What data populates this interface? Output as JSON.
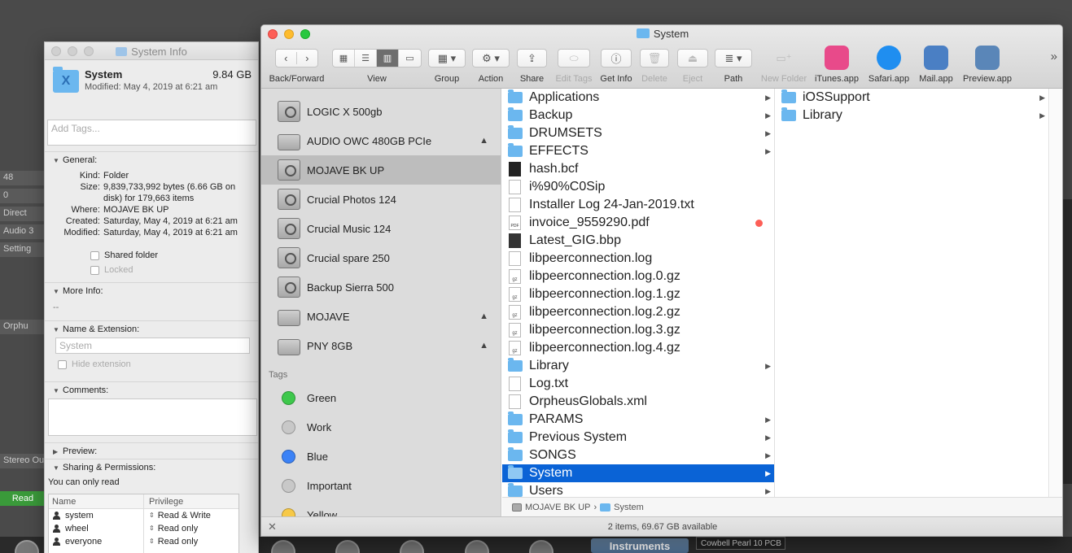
{
  "background": {
    "strips": [
      "48",
      "0",
      "Direct",
      "Audio 3",
      "Setting",
      "Orphu",
      "Stereo Ou"
    ],
    "read_label": "Read",
    "instruments_label": "Instruments",
    "cowbell_label": "Cowbell Pearl 10 PCB"
  },
  "info": {
    "title": "System Info",
    "name": "System",
    "size": "9.84 GB",
    "modified_line": "Modified: May 4, 2019 at 6:21 am",
    "tags_placeholder": "Add Tags...",
    "general": {
      "heading": "General:",
      "rows": [
        {
          "k": "Kind:",
          "v": "Folder"
        },
        {
          "k": "Size:",
          "v": "9,839,733,992 bytes (6.66 GB on disk) for 179,663 items"
        },
        {
          "k": "Where:",
          "v": "MOJAVE BK UP"
        },
        {
          "k": "Created:",
          "v": "Saturday, May 4, 2019 at 6:21 am"
        },
        {
          "k": "Modified:",
          "v": "Saturday, May 4, 2019 at 6:21 am"
        }
      ],
      "shared_folder": "Shared folder",
      "locked": "Locked"
    },
    "more_info": {
      "heading": "More Info:",
      "value": "--"
    },
    "name_ext": {
      "heading": "Name & Extension:",
      "field_placeholder": "System",
      "hide_extension": "Hide extension"
    },
    "comments": {
      "heading": "Comments:"
    },
    "preview": {
      "heading": "Preview:"
    },
    "sharing": {
      "heading": "Sharing & Permissions:",
      "note": "You can only read",
      "col_name": "Name",
      "col_privilege": "Privilege",
      "rows": [
        {
          "name": "system",
          "privilege": "Read & Write"
        },
        {
          "name": "wheel",
          "privilege": "Read only"
        },
        {
          "name": "everyone",
          "privilege": "Read only"
        }
      ]
    }
  },
  "finder": {
    "title": "System",
    "toolbar": {
      "back_forward": "Back/Forward",
      "view": "View",
      "group": "Group",
      "action": "Action",
      "share": "Share",
      "edit_tags": "Edit Tags",
      "get_info": "Get Info",
      "delete": "Delete",
      "eject": "Eject",
      "path": "Path",
      "new_folder": "New Folder",
      "apps": [
        "iTunes.app",
        "Safari.app",
        "Mail.app",
        "Preview.app"
      ],
      "app_colors": [
        "#e84a8a",
        "#1f8ef0",
        "#4a7fc4",
        "#5a86b8"
      ]
    },
    "sidebar": {
      "devices": [
        {
          "label": "LOGIC X 500gb",
          "eject": ""
        },
        {
          "label": "AUDIO OWC 480GB PCIe",
          "eject": "▲"
        },
        {
          "label": "MOJAVE BK UP",
          "eject": ""
        },
        {
          "label": "Crucial Photos 124",
          "eject": ""
        },
        {
          "label": "Crucial Music 124",
          "eject": ""
        },
        {
          "label": "Crucial spare 250",
          "eject": ""
        },
        {
          "label": "Backup Sierra 500",
          "eject": ""
        },
        {
          "label": "MOJAVE",
          "eject": "▲"
        },
        {
          "label": "PNY 8GB",
          "eject": "▲"
        }
      ],
      "tags_heading": "Tags",
      "tags": [
        {
          "label": "Green",
          "color": "#3ec84c"
        },
        {
          "label": "Work",
          "color": "#c8c8c8"
        },
        {
          "label": "Blue",
          "color": "#3b82f6"
        },
        {
          "label": "Important",
          "color": "#c8c8c8"
        },
        {
          "label": "Yellow",
          "color": "#f7c948"
        }
      ]
    },
    "column1": [
      {
        "label": "Applications",
        "kind": "folder"
      },
      {
        "label": "Backup",
        "kind": "folder"
      },
      {
        "label": "DRUMSETS",
        "kind": "folder"
      },
      {
        "label": "EFFECTS",
        "kind": "folder"
      },
      {
        "label": "hash.bcf",
        "kind": "term"
      },
      {
        "label": "i%90%C0Sip",
        "kind": "doc"
      },
      {
        "label": "Installer Log 24-Jan-2019.txt",
        "kind": "doc"
      },
      {
        "label": "invoice_9559290.pdf",
        "kind": "pdf"
      },
      {
        "label": "Latest_GIG.bbp",
        "kind": "bbp"
      },
      {
        "label": "libpeerconnection.log",
        "kind": "doc"
      },
      {
        "label": "libpeerconnection.log.0.gz",
        "kind": "gz"
      },
      {
        "label": "libpeerconnection.log.1.gz",
        "kind": "gz"
      },
      {
        "label": "libpeerconnection.log.2.gz",
        "kind": "gz"
      },
      {
        "label": "libpeerconnection.log.3.gz",
        "kind": "gz"
      },
      {
        "label": "libpeerconnection.log.4.gz",
        "kind": "gz"
      },
      {
        "label": "Library",
        "kind": "folder"
      },
      {
        "label": "Log.txt",
        "kind": "doc"
      },
      {
        "label": "OrpheusGlobals.xml",
        "kind": "doc"
      },
      {
        "label": "PARAMS",
        "kind": "folder"
      },
      {
        "label": "Previous System",
        "kind": "folder"
      },
      {
        "label": "SONGS",
        "kind": "folder"
      },
      {
        "label": "System",
        "kind": "folder"
      },
      {
        "label": "Users",
        "kind": "folder"
      }
    ],
    "column2": [
      {
        "label": "iOSSupport"
      },
      {
        "label": "Library"
      }
    ],
    "pathbar": {
      "disk": "MOJAVE BK UP",
      "sep": "›",
      "folder": "System"
    },
    "status": "2 items, 69.67 GB available"
  }
}
